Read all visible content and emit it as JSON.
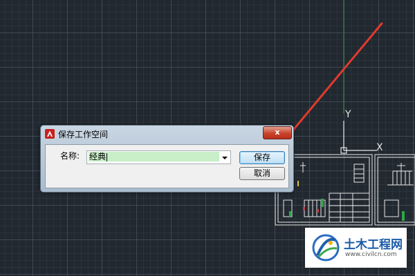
{
  "dialog": {
    "title": "保存工作空间",
    "close_label": "x",
    "name_label": "名称:",
    "name_value": "经典",
    "save_label": "保存",
    "cancel_label": "取消"
  },
  "canvas": {
    "ucs_y_label": "Y",
    "ucs_x_label": "X"
  },
  "watermark": {
    "title": "土木工程网",
    "url": "www.civilcn.com"
  },
  "colors": {
    "canvas_bg": "#212830",
    "arrow": "#e23a2e",
    "y_axis": "#2a8a3a"
  }
}
